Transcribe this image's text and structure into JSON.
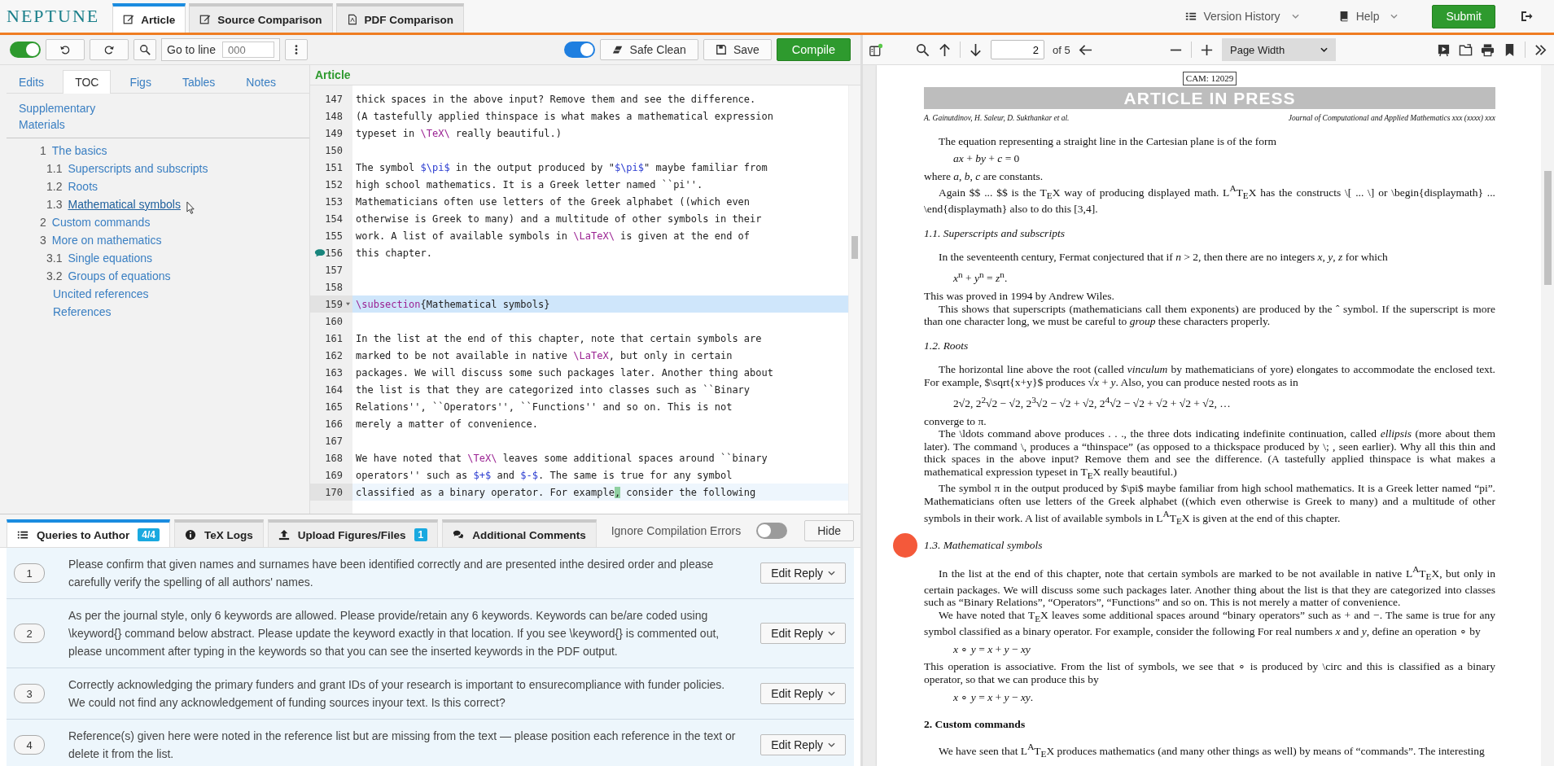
{
  "app": {
    "logo": "NEPTUNE",
    "tabs": [
      {
        "label": "Article",
        "selected": true
      },
      {
        "label": "Source Comparison",
        "selected": false
      },
      {
        "label": "PDF Comparison",
        "selected": false
      }
    ],
    "menus": [
      {
        "label": "Version History"
      },
      {
        "label": "Help"
      }
    ],
    "submit": "Submit"
  },
  "editor_toolbar": {
    "track_on": true,
    "goto_label": "Go to line",
    "goto_placeholder": "000",
    "sync_on": true,
    "safe_clean": "Safe Clean",
    "save": "Save",
    "compile": "Compile"
  },
  "side_tabs": [
    {
      "label": "Edits",
      "selected": false
    },
    {
      "label": "TOC",
      "selected": true
    },
    {
      "label": "Figs",
      "selected": false
    },
    {
      "label": "Tables",
      "selected": false
    },
    {
      "label": "Notes",
      "selected": false
    }
  ],
  "toc": {
    "supplementary": "Supplementary Materials",
    "items": [
      {
        "num": "1",
        "label": "The basics",
        "hovered": false,
        "children": [
          {
            "num": "1.1",
            "label": "Superscripts and subscripts",
            "hovered": false
          },
          {
            "num": "1.2",
            "label": "Roots",
            "hovered": false
          },
          {
            "num": "1.3",
            "label": "Mathematical symbols",
            "hovered": true
          }
        ]
      },
      {
        "num": "2",
        "label": "Custom commands",
        "hovered": false
      },
      {
        "num": "3",
        "label": "More on mathematics",
        "hovered": false,
        "children": [
          {
            "num": "3.1",
            "label": "Single equations",
            "hovered": false
          },
          {
            "num": "3.2",
            "label": "Groups of equations",
            "hovered": false
          }
        ]
      },
      {
        "label": "Uncited references",
        "hovered": false
      },
      {
        "label": "References",
        "hovered": false
      }
    ]
  },
  "editor": {
    "title": "Article",
    "lines": [
      {
        "n": "147",
        "s": [
          {
            "t": "thick spaces in the above input? Remove them and see the difference."
          }
        ]
      },
      {
        "n": "148",
        "s": [
          {
            "t": "(A tastefully applied thinspace is what makes a mathematical expression"
          }
        ]
      },
      {
        "n": "149",
        "s": [
          {
            "t": "typeset in "
          },
          {
            "kind": "cmd",
            "t": "\\TeX\\"
          },
          {
            "t": " really beautiful.)"
          }
        ]
      },
      {
        "n": "150"
      },
      {
        "n": "151",
        "s": [
          {
            "t": "The symbol "
          },
          {
            "kind": "math",
            "t": "$\\pi$"
          },
          {
            "t": " in the output produced by \""
          },
          {
            "kind": "math",
            "t": "$\\pi$"
          },
          {
            "t": "\" maybe familiar from"
          }
        ]
      },
      {
        "n": "152",
        "s": [
          {
            "t": "high school mathematics. It is a Greek letter named ``pi''."
          }
        ]
      },
      {
        "n": "153",
        "s": [
          {
            "t": "Mathematicians often use letters of the Greek alphabet ((which even"
          }
        ]
      },
      {
        "n": "154",
        "s": [
          {
            "t": "otherwise is Greek to many) and a multitude of other symbols in their"
          }
        ]
      },
      {
        "n": "155",
        "s": [
          {
            "t": "work. A list of available symbols in "
          },
          {
            "kind": "cmd",
            "t": "\\LaTeX\\"
          },
          {
            "t": " is given at the end of"
          }
        ]
      },
      {
        "n": "156",
        "comment": true,
        "s": [
          {
            "t": "this chapter."
          }
        ]
      },
      {
        "n": "157"
      },
      {
        "n": "158"
      },
      {
        "n": "159",
        "fold": true,
        "active": true,
        "s": [
          {
            "kind": "cmd",
            "t": "\\subsection"
          },
          {
            "t": "{Mathematical symbols}"
          }
        ]
      },
      {
        "n": "160"
      },
      {
        "n": "161",
        "s": [
          {
            "t": "In the list at the end of this chapter, note that certain symbols are"
          }
        ]
      },
      {
        "n": "162",
        "s": [
          {
            "t": "marked to be not available in native "
          },
          {
            "kind": "cmd",
            "t": "\\LaTeX"
          },
          {
            "t": ", but only in certain"
          }
        ]
      },
      {
        "n": "163",
        "s": [
          {
            "t": "packages. We will discuss some such packages later. Another thing about"
          }
        ]
      },
      {
        "n": "164",
        "s": [
          {
            "t": "the list is that they are categorized into classes such as ``Binary"
          }
        ]
      },
      {
        "n": "165",
        "s": [
          {
            "t": "Relations'', ``Operators'', ``Functions'' and so on. This is not"
          }
        ]
      },
      {
        "n": "166",
        "s": [
          {
            "t": "merely a matter of convenience."
          }
        ]
      },
      {
        "n": "167"
      },
      {
        "n": "168",
        "s": [
          {
            "t": "We have noted that "
          },
          {
            "kind": "cmd",
            "t": "\\TeX\\"
          },
          {
            "t": " leaves some additional spaces around ``binary"
          }
        ]
      },
      {
        "n": "169",
        "s": [
          {
            "t": "operators'' such as "
          },
          {
            "kind": "math",
            "t": "$+$"
          },
          {
            "t": " and "
          },
          {
            "kind": "math",
            "t": "$-$"
          },
          {
            "t": ". The same is true for any symbol"
          }
        ]
      },
      {
        "n": "170",
        "cursor_line": true,
        "s": [
          {
            "t": "classified as a binary operator. For example"
          },
          {
            "kind": "cursor",
            "t": ","
          },
          {
            "t": " consider the following"
          }
        ]
      }
    ]
  },
  "bottom_panel": {
    "tabs": [
      {
        "label": "Queries to Author",
        "badge": "4/4",
        "selected": true
      },
      {
        "label": "TeX Logs",
        "selected": false
      },
      {
        "label": "Upload Figures/Files",
        "badge": "1",
        "selected": false
      },
      {
        "label": "Additional Comments",
        "selected": false
      }
    ],
    "ignore_errors": {
      "label": "Ignore Compilation Errors",
      "on": false
    },
    "hide": "Hide",
    "queries": [
      {
        "num": "1",
        "text": "Please confirm that given names and surnames have been identified correctly and are presented inthe desired order and please carefully verify the spelling of all authors' names.",
        "action": "Edit Reply"
      },
      {
        "num": "2",
        "text": "As per the journal style, only 6 keywords are allowed. Please provide/retain any 6 keywords. Keywords can be/are coded using \\keyword{} command below abstract. Please update the keyword exactly in that location. If you see \\keyword{} is commented out, please uncomment after typing in the keywords so that you can see the inserted keywords in the PDF output.",
        "action": "Edit Reply"
      },
      {
        "num": "3",
        "text": "Correctly acknowledging the primary funders and grant IDs of your research is important to ensurecompliance with funder policies. We could not find any acknowledgement of funding sources inyour text. Is this correct?",
        "action": "Edit Reply"
      },
      {
        "num": "4",
        "text": "Reference(s) given here were noted in the reference list but are missing from the text — please position each reference in the text or delete it from the list.",
        "action": "Edit Reply"
      }
    ]
  },
  "pdf_viewer": {
    "page": "2",
    "of": "of 5",
    "zoom": "Page Width",
    "document": {
      "stamp": "CAM: 12029",
      "banner": "ARTICLE IN PRESS",
      "authors": "A. Gainutdinov, H. Saleur, D. Sukthankar et al.",
      "journal": "Journal of Computational and Applied Mathematics xxx (xxxx) xxx",
      "blocks": [
        {
          "kind": "para",
          "indent": true,
          "text": "The equation representing a straight line in the Cartesian plane is of the form"
        },
        {
          "kind": "eq",
          "text": "*ax* + *by* + *c* = 0"
        },
        {
          "kind": "para",
          "indent": false,
          "text": "where *a*, *b*, *c* are constants."
        },
        {
          "kind": "para",
          "indent": true,
          "text": "Again $$ ... $$ is the T$_{E}$X way of producing displayed math. L$^{A}$T$_{E}$X has the constructs \\[ ... \\] or \\begin{displaymath} ... \\end{displaymath} also to do this [3,4]."
        },
        {
          "kind": "subheading",
          "text": "1.1.  Superscripts and subscripts"
        },
        {
          "kind": "para",
          "indent": true,
          "text": "In the seventeenth century, Fermat conjectured that if *n* > 2, then there are no integers *x*, *y*, *z* for which"
        },
        {
          "kind": "eq",
          "text": "*x*$^{n}$ + *y*$^{n}$ = *z*$^{n}$."
        },
        {
          "kind": "para",
          "indent": false,
          "text": "This was proved in 1994 by Andrew Wiles."
        },
        {
          "kind": "para",
          "indent": true,
          "text": "This shows that superscripts (mathematicians call them exponents) are produced by the ˆ symbol. If the superscript is more than one character long, we must be careful to *group* these characters properly."
        },
        {
          "kind": "subheading",
          "text": "1.2.  Roots"
        },
        {
          "kind": "para",
          "indent": true,
          "text": "The horizontal line above the root (called *vinculum* by mathematicians of yore) elongates to accommodate the enclosed text. For example, $\\sqrt{x+y}$ produces √*x* + *y*. Also, you can produce nested roots as in"
        },
        {
          "kind": "eq",
          "text": "2√2,   2$^{2}$√2 − √2,   2$^{3}$√2 − √2 + √2,   2$^{4}$√2 − √2 + √2 + √2 + √2, …"
        },
        {
          "kind": "para",
          "indent": false,
          "text": "converge to π."
        },
        {
          "kind": "para",
          "indent": true,
          "text": "The \\ldots command above produces . . ., the three dots indicating indefinite continuation, called *ellipsis* (more about them later). The command \\, produces a “thinspace” (as opposed to a thickspace produced by \\; , seen earlier). Why all this thin and thick spaces in the above input? Remove them and see the difference. (A tastefully applied thinspace is what makes a mathematical expression typeset in T$_{E}$X really beautiful.)"
        },
        {
          "kind": "para",
          "indent": true,
          "text": "The symbol π in the output produced by $\\pi$ maybe familiar from high school mathematics. It is a Greek letter named “pi”. Mathematicians often use letters of the Greek alphabet ((which even otherwise is Greek to many) and a multitude of other symbols in their work. A list of available symbols in L$^{A}$T$_{E}$X is given at the end of this chapter."
        },
        {
          "kind": "subheading",
          "marked": true,
          "text": "1.3.  Mathematical symbols"
        },
        {
          "kind": "para",
          "indent": true,
          "text": "In the list at the end of this chapter, note that certain symbols are marked to be not available in native L$^{A}$T$_{E}$X, but only in certain packages. We will discuss some such packages later. Another thing about the list is that they are categorized into classes such as “Binary Relations”, “Operators”, “Functions” and so on. This is not merely a matter of convenience."
        },
        {
          "kind": "para",
          "indent": true,
          "text": "We have noted that T$_{E}$X leaves some additional spaces around “binary operators” such as + and −. The same is true for any symbol classified as a binary operator. For example, consider the following  For real numbers *x* and *y*, define an operation ∘ by"
        },
        {
          "kind": "eq",
          "text": "*x* ∘ *y* = *x* + *y* − *xy*"
        },
        {
          "kind": "para",
          "indent": false,
          "text": "This operation is associative.  From the list of symbols, we see that ∘ is produced by \\circ and this is classified as a binary operator, so that we can produce this by"
        },
        {
          "kind": "eq",
          "text": "*x* ∘ *y* = *x* + *y* − *xy*."
        },
        {
          "kind": "heading",
          "text": "2.  Custom commands"
        },
        {
          "kind": "para",
          "indent": true,
          "text": "We have seen that L$^{A}$T$_{E}$X produces mathematics (and many other things as well) by means of “commands”. The interesting"
        }
      ]
    }
  }
}
